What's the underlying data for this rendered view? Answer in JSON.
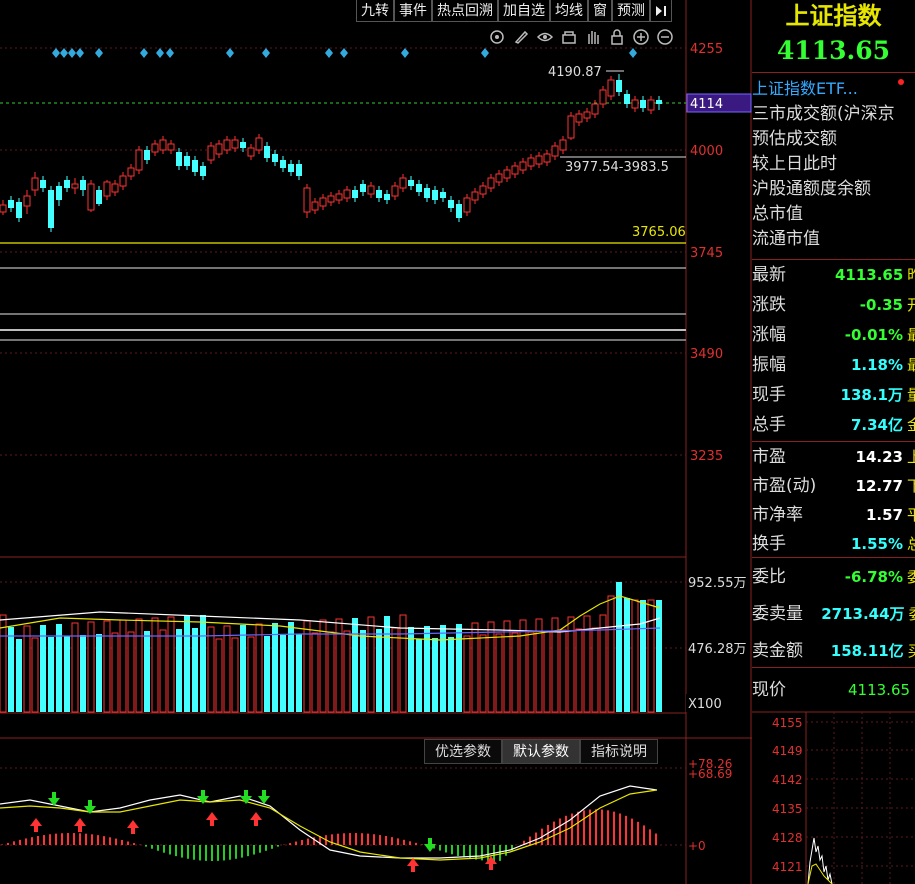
{
  "toolbar": [
    "九转",
    "事件",
    "热点回溯",
    "加自选",
    "均线",
    "窗",
    "预测"
  ],
  "toolbar_end_icon": "collapse-right-icon",
  "chart_icons": [
    "settings-icon",
    "pen-icon",
    "eye-icon",
    "lock-box-icon",
    "hand-icon",
    "lock-icon",
    "zoom-in-icon",
    "zoom-out-icon"
  ],
  "price_axis": {
    "ticks": [
      "4255",
      "4000",
      "3745",
      "3490",
      "3235"
    ],
    "current": "4114"
  },
  "annotations": {
    "high": "4190.87",
    "range": "3977.54-3983.5",
    "support": "3765.06"
  },
  "volume_axis": {
    "ticks": [
      "952.55万",
      "476.28万"
    ],
    "unit": "X100"
  },
  "indicator": {
    "tabs": [
      "优选参数",
      "默认参数",
      "指标说明"
    ],
    "active_tab": 1,
    "axis": [
      "+78.26",
      "+68.69",
      "+0"
    ]
  },
  "quote": {
    "name": "上证指数",
    "price": "4113.65",
    "etf_link": "上证指数ETF...",
    "info_lines": [
      "三市成交额(沪深京",
      "预估成交额",
      "较上日此时",
      "沪股通额度余额",
      "总市值",
      "流通市值"
    ],
    "stats": [
      {
        "label": "最新",
        "value": "4113.65",
        "color": "#33ff33",
        "suffix": "昨"
      },
      {
        "label": "涨跌",
        "value": "-0.35",
        "color": "#33ff33",
        "suffix": "开"
      },
      {
        "label": "涨幅",
        "value": "-0.01%",
        "color": "#33ff33",
        "suffix": "最"
      },
      {
        "label": "振幅",
        "value": "1.18%",
        "color": "#33ffff",
        "suffix": "最"
      },
      {
        "label": "现手",
        "value": "138.1万",
        "color": "#33ffff",
        "suffix": "量"
      },
      {
        "label": "总手",
        "value": "7.34亿",
        "color": "#33ffff",
        "suffix": "金"
      }
    ],
    "valuation": [
      {
        "label": "市盈",
        "value": "14.23",
        "suffix": "上"
      },
      {
        "label": "市盈(动)",
        "value": "12.77",
        "suffix": "下"
      },
      {
        "label": "市净率",
        "value": "1.57",
        "suffix": "平"
      },
      {
        "label": "换手",
        "value": "1.55%",
        "suffix": "总",
        "color": "#33ffff"
      }
    ],
    "orders": [
      {
        "label": "委比",
        "value": "-6.78%",
        "color": "#33ff33",
        "suffix": "委"
      },
      {
        "label": "委卖量",
        "value": "2713.44万",
        "color": "#33ffff",
        "suffix": "委"
      },
      {
        "label": "卖金额",
        "value": "158.11亿",
        "color": "#33ffff",
        "suffix": "买"
      }
    ],
    "current_label": "现价",
    "current_value": "4113.65",
    "mini_axis": [
      "4155",
      "4149",
      "4142",
      "4135",
      "4128",
      "4121"
    ]
  }
}
